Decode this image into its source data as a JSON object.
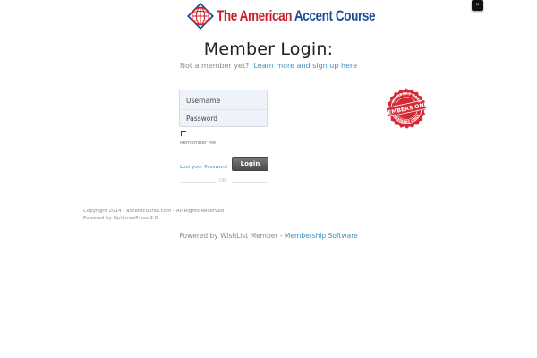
{
  "header": {
    "logo_the": "The ",
    "logo_american": "American ",
    "logo_accent": "Accent Course",
    "corner_button": "×"
  },
  "login": {
    "title": "Member Login:",
    "not_member_text": "Not a member yet?",
    "signup_link": "Learn more and sign up here",
    "username_placeholder": "Username",
    "password_placeholder": "Password",
    "remember_me": "Remember Me",
    "lost_password": "Lost your Password",
    "login_button": "Login",
    "or_text": "OR"
  },
  "badge": {
    "top_text": "MEMBERS ONLY",
    "center_text": "MEMBERS ONLY",
    "bottom_text": "MEMBERS ONLY",
    "color": "#d42a35"
  },
  "footer": {
    "copyright": "Copyright 2014 - accentcourse.com - All Rights Reserved",
    "powered_op": "Powered by OptimizePress 2.0",
    "powered_wl_prefix": "Powered by WishList Member - ",
    "powered_wl_link": "Membership Software"
  },
  "colors": {
    "link": "#3b8fc4",
    "brand_red": "#c8202a",
    "brand_blue": "#1f4e9a"
  }
}
